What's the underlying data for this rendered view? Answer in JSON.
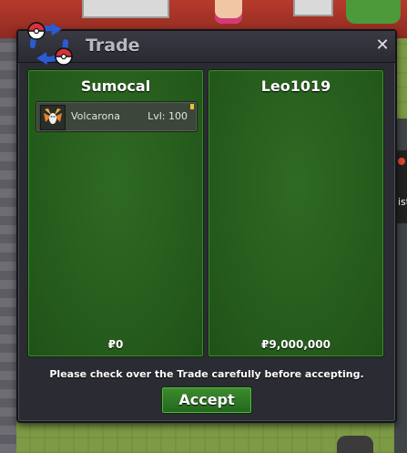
{
  "window": {
    "title": "Trade",
    "close_label": "✕",
    "notice": "Please check over the Trade carefully before accepting.",
    "accept_label": "Accept"
  },
  "left_panel": {
    "player_name": "Sumocal",
    "money": "₽0",
    "pokemon": [
      {
        "name": "Volcarona",
        "level": "Lvl: 100"
      }
    ]
  },
  "right_panel": {
    "player_name": "Leo1019",
    "money": "₽9,000,000",
    "pokemon": []
  },
  "background": {
    "side_letters": "ist"
  },
  "colors": {
    "panel_green": "#245a1b",
    "window_bg": "#2b2b33",
    "accept_green": "#2f7a25",
    "icon_red": "#d8323a",
    "icon_blue": "#2a5bd0"
  }
}
